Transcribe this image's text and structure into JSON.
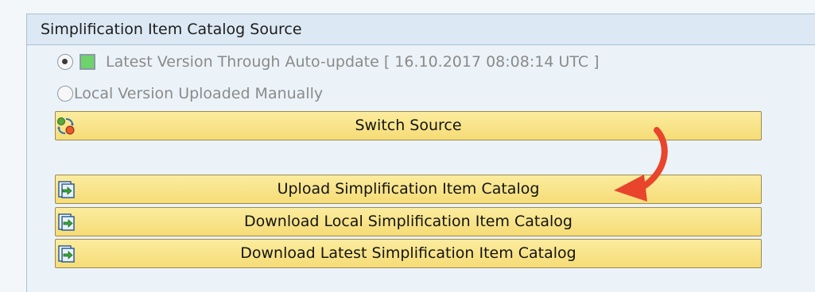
{
  "panel": {
    "title": "Simplification Item Catalog Source"
  },
  "options": {
    "latest_label": "Latest Version Through Auto-update [ 16.10.2017 08:08:14 UTC ]",
    "latest_selected": true,
    "local_label": "Local Version Uploaded Manually",
    "local_selected": false
  },
  "status": {
    "color": "#6ed36a"
  },
  "buttons": {
    "switch_source": "Switch Source",
    "upload_catalog": "Upload Simplification Item Catalog",
    "download_local": "Download Local Simplification Item Catalog",
    "download_latest": "Download Latest Simplification Item Catalog"
  },
  "icons": {
    "switch": "switch-source-icon",
    "upload": "upload-icon",
    "download": "download-icon"
  },
  "colors": {
    "button_bg": "#f9e388",
    "annotation_arrow": "#e8452c"
  }
}
